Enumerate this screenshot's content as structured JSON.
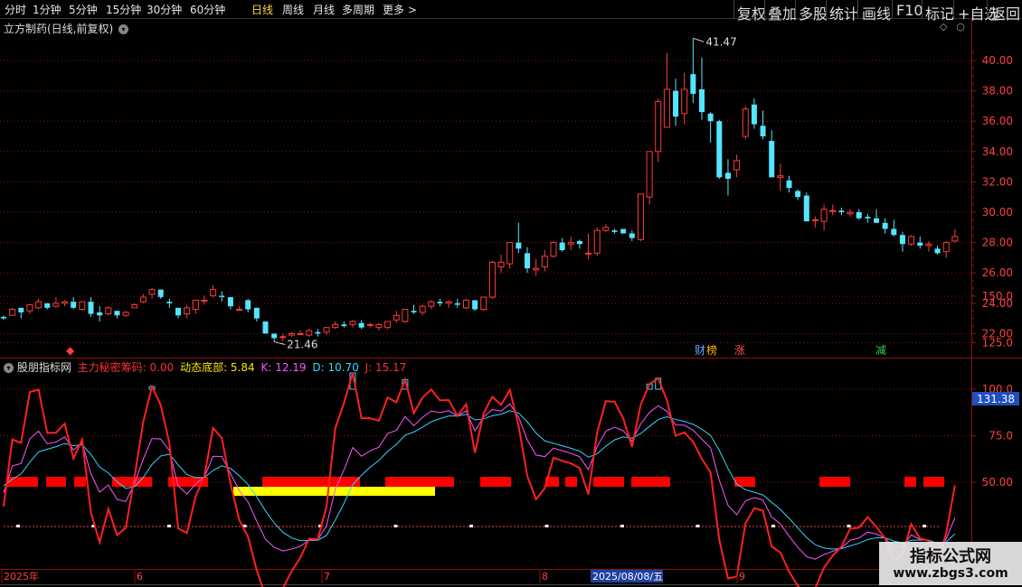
{
  "toolbar": {
    "periods": [
      "分时",
      "1分钟",
      "5分钟",
      "15分钟",
      "30分钟",
      "60分钟",
      "日线",
      "周线",
      "月线",
      "多周期",
      "更多"
    ],
    "active_period": "日线",
    "more_arrow": ">",
    "actions": [
      "复权",
      "叠加",
      "多股",
      "统计",
      "画线",
      "F10",
      "标记",
      "+自选",
      "返回"
    ]
  },
  "main_chart": {
    "title": "立方制药(日线,前复权)",
    "y_labels": [
      "40.00",
      "38.00",
      "36.00",
      "34.00",
      "32.00",
      "30.00",
      "28.00",
      "26.00",
      "24.00",
      "22.00"
    ],
    "high_label": "41.47",
    "low_label": "21.46",
    "event_markers": [
      {
        "text": "◆",
        "color": "#ff3b3b"
      },
      {
        "text": "财",
        "color": "#6aa8ff"
      },
      {
        "text": "榜",
        "color": "#ffb400"
      },
      {
        "text": "涨",
        "color": "#ff4a4a"
      },
      {
        "text": "减",
        "color": "#33d14a"
      }
    ]
  },
  "indicator": {
    "name": "股朋指标网",
    "values": [
      {
        "label": "主力秘密筹码: 0.00",
        "color": "#ff3030"
      },
      {
        "label": "动态底部: 5.84",
        "color": "#ffe600"
      },
      {
        "label": "K: 12.19",
        "color": "#ff55ff"
      },
      {
        "label": "D: 10.70",
        "color": "#33d6ff"
      },
      {
        "label": "J: 15.17",
        "color": "#ff3030"
      }
    ],
    "y_labels": [
      "150.0",
      "125.0",
      "100.0",
      "75.0",
      "50.00"
    ],
    "current_value": "131.38"
  },
  "time_axis": {
    "labels": [
      "2025年",
      "6",
      "7",
      "8",
      "9"
    ],
    "selected_date": "2025/08/08/五"
  },
  "watermark": {
    "title": "指标公式网",
    "url": "www.zbgs3.com"
  },
  "colors": {
    "up": "#ff3b3b",
    "down": "#54e5ff",
    "grid": "#8a1010",
    "active": "#ffd24a",
    "block_red": "#ff0000",
    "block_yellow": "#ffff00"
  },
  "chart_data": {
    "type": "candlestick",
    "y_range": [
      21.0,
      41.5
    ],
    "candles": [
      [
        23.1,
        23.2,
        22.9,
        23.0
      ],
      [
        23.2,
        23.7,
        23.2,
        23.6
      ],
      [
        23.7,
        23.7,
        23.0,
        23.4
      ],
      [
        23.5,
        23.9,
        23.3,
        23.9
      ],
      [
        23.7,
        24.3,
        23.6,
        24.1
      ],
      [
        24.0,
        24.0,
        23.6,
        23.7
      ],
      [
        23.8,
        24.4,
        23.7,
        24.0
      ],
      [
        24.0,
        24.2,
        23.8,
        24.1
      ],
      [
        24.1,
        24.4,
        23.6,
        23.7
      ],
      [
        23.6,
        24.1,
        23.5,
        24.1
      ],
      [
        24.1,
        24.4,
        23.1,
        23.3
      ],
      [
        23.4,
        23.8,
        22.8,
        23.2
      ],
      [
        23.3,
        23.8,
        23.2,
        23.7
      ],
      [
        23.5,
        23.5,
        23.0,
        23.2
      ],
      [
        23.2,
        23.5,
        23.1,
        23.4
      ],
      [
        23.7,
        24.0,
        23.7,
        23.9
      ],
      [
        24.1,
        24.6,
        24.0,
        24.4
      ],
      [
        24.6,
        25.0,
        24.3,
        24.9
      ],
      [
        24.9,
        24.9,
        24.3,
        24.4
      ],
      [
        24.1,
        24.3,
        23.7,
        24.0
      ],
      [
        23.7,
        23.7,
        23.0,
        23.2
      ],
      [
        23.3,
        23.9,
        23.0,
        23.7
      ],
      [
        23.6,
        24.2,
        23.3,
        24.2
      ],
      [
        24.2,
        24.5,
        23.9,
        24.2
      ],
      [
        24.5,
        25.2,
        24.4,
        24.9
      ],
      [
        24.5,
        24.8,
        24.1,
        24.4
      ],
      [
        24.4,
        24.4,
        23.6,
        23.8
      ],
      [
        23.6,
        23.8,
        23.5,
        23.6
      ],
      [
        24.2,
        24.3,
        23.4,
        23.6
      ],
      [
        23.7,
        23.7,
        22.8,
        23.0
      ],
      [
        22.8,
        22.8,
        22.0,
        22.0
      ],
      [
        22.0,
        22.0,
        21.46,
        21.7
      ],
      [
        21.8,
        22.0,
        21.5,
        21.8
      ],
      [
        21.9,
        22.1,
        21.8,
        22.0
      ],
      [
        22.0,
        22.2,
        21.9,
        22.0
      ],
      [
        21.9,
        22.3,
        21.8,
        22.2
      ],
      [
        22.1,
        22.3,
        21.8,
        22.0
      ],
      [
        22.1,
        22.4,
        21.9,
        22.4
      ],
      [
        22.4,
        22.8,
        22.3,
        22.6
      ],
      [
        22.6,
        22.8,
        22.4,
        22.5
      ],
      [
        22.6,
        22.9,
        22.4,
        22.8
      ],
      [
        22.7,
        22.9,
        22.3,
        22.4
      ],
      [
        22.6,
        22.7,
        22.4,
        22.6
      ],
      [
        22.4,
        22.7,
        22.2,
        22.6
      ],
      [
        22.4,
        22.8,
        22.3,
        22.8
      ],
      [
        22.9,
        23.5,
        22.7,
        23.2
      ],
      [
        22.8,
        23.6,
        22.7,
        23.6
      ],
      [
        23.5,
        23.9,
        23.3,
        23.4
      ],
      [
        23.4,
        23.9,
        23.2,
        23.8
      ],
      [
        23.8,
        24.2,
        23.6,
        24.1
      ],
      [
        24.1,
        24.3,
        23.8,
        24.0
      ],
      [
        24.0,
        24.2,
        23.7,
        24.1
      ],
      [
        24.0,
        24.3,
        23.7,
        23.9
      ],
      [
        23.7,
        24.3,
        23.6,
        24.2
      ],
      [
        24.2,
        24.2,
        23.5,
        23.6
      ],
      [
        23.6,
        24.4,
        23.5,
        24.4
      ],
      [
        24.4,
        26.8,
        24.3,
        26.7
      ],
      [
        26.4,
        27.2,
        26.0,
        26.7
      ],
      [
        26.6,
        28.0,
        26.3,
        28.0
      ],
      [
        28.0,
        29.3,
        27.3,
        27.6
      ],
      [
        27.3,
        27.7,
        26.0,
        26.3
      ],
      [
        26.2,
        26.9,
        25.8,
        26.3
      ],
      [
        26.4,
        27.5,
        26.1,
        27.1
      ],
      [
        27.1,
        28.1,
        27.0,
        28.0
      ],
      [
        28.0,
        28.3,
        27.4,
        27.5
      ],
      [
        27.9,
        28.4,
        27.5,
        28.0
      ],
      [
        28.1,
        28.2,
        27.6,
        27.9
      ],
      [
        27.3,
        28.6,
        26.9,
        27.3
      ],
      [
        27.3,
        29.0,
        27.1,
        28.8
      ],
      [
        28.8,
        29.2,
        28.7,
        29.0
      ],
      [
        28.8,
        28.9,
        28.6,
        28.7
      ],
      [
        28.9,
        28.9,
        28.7,
        28.6
      ],
      [
        28.6,
        28.8,
        28.1,
        28.3
      ],
      [
        28.2,
        31.2,
        28.1,
        31.2
      ],
      [
        31.0,
        34.0,
        30.5,
        34.0
      ],
      [
        34.0,
        37.5,
        33.3,
        37.3
      ],
      [
        35.6,
        40.5,
        35.6,
        38.1
      ],
      [
        38.0,
        38.8,
        35.7,
        36.3
      ],
      [
        36.5,
        39.2,
        35.8,
        38.1
      ],
      [
        39.1,
        41.47,
        37.2,
        37.8
      ],
      [
        38.1,
        40.2,
        36.1,
        36.6
      ],
      [
        36.5,
        36.6,
        34.6,
        36.0
      ],
      [
        36.0,
        36.1,
        32.2,
        32.3
      ],
      [
        32.6,
        33.5,
        31.1,
        32.2
      ],
      [
        32.8,
        33.8,
        32.3,
        33.4
      ],
      [
        35.0,
        37.0,
        34.8,
        36.8
      ],
      [
        37.1,
        37.5,
        35.5,
        35.8
      ],
      [
        35.7,
        36.7,
        34.8,
        35.0
      ],
      [
        34.7,
        35.4,
        32.7,
        32.3
      ],
      [
        32.3,
        33.2,
        31.4,
        32.4
      ],
      [
        32.1,
        32.4,
        31.3,
        31.6
      ],
      [
        31.4,
        31.5,
        30.8,
        31.0
      ],
      [
        31.1,
        31.3,
        29.4,
        29.4
      ],
      [
        29.5,
        29.7,
        29.0,
        29.5
      ],
      [
        29.4,
        30.5,
        28.8,
        30.2
      ],
      [
        30.1,
        30.5,
        29.8,
        30.1
      ],
      [
        30.1,
        30.3,
        29.8,
        30.0
      ],
      [
        29.9,
        30.2,
        29.7,
        30.0
      ],
      [
        30.0,
        30.2,
        29.5,
        29.6
      ],
      [
        29.7,
        29.9,
        29.3,
        29.6
      ],
      [
        29.6,
        30.2,
        29.3,
        29.3
      ],
      [
        29.3,
        29.6,
        28.6,
        28.9
      ],
      [
        28.9,
        29.5,
        28.4,
        28.5
      ],
      [
        28.5,
        28.7,
        27.4,
        27.9
      ],
      [
        27.9,
        28.5,
        27.8,
        28.4
      ],
      [
        28.0,
        28.4,
        27.6,
        27.8
      ],
      [
        27.8,
        28.1,
        27.4,
        27.9
      ],
      [
        27.6,
        27.8,
        27.2,
        27.3
      ],
      [
        27.4,
        28.1,
        27.0,
        28.0
      ],
      [
        28.1,
        28.9,
        28.0,
        28.4
      ]
    ]
  }
}
